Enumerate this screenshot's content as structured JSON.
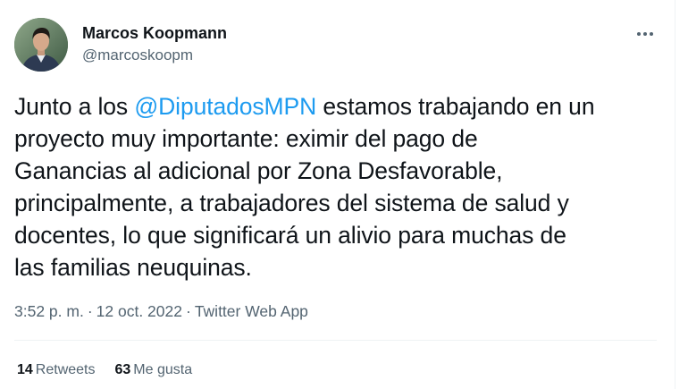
{
  "tweet": {
    "author": {
      "display_name": "Marcos Koopmann",
      "handle": "@marcoskoopm"
    },
    "more_icon": "more-horizontal-icon",
    "text": {
      "line1_pre": "Junto a los ",
      "mention": "@DiputadosMPN",
      "line1_post": " estamos trabajando en un",
      "line2": "proyecto muy importante: eximir del pago de",
      "line3": "Ganancias al adicional por Zona Desfavorable,",
      "line4": "principalmente, a trabajadores del sistema de salud y",
      "line5": "docentes, lo que significará un alivio para muchas de",
      "line6": "las familias neuquinas."
    },
    "meta": {
      "time": "3:52 p. m.",
      "separator": "·",
      "date": "12 oct. 2022",
      "source": "Twitter Web App"
    },
    "stats": {
      "retweets_count": "14",
      "retweets_label": "Retweets",
      "likes_count": "63",
      "likes_label": "Me gusta"
    },
    "colors": {
      "link": "#1d9bf0",
      "text": "#0f1419",
      "secondary": "#536471",
      "border": "#eff3f4"
    }
  }
}
